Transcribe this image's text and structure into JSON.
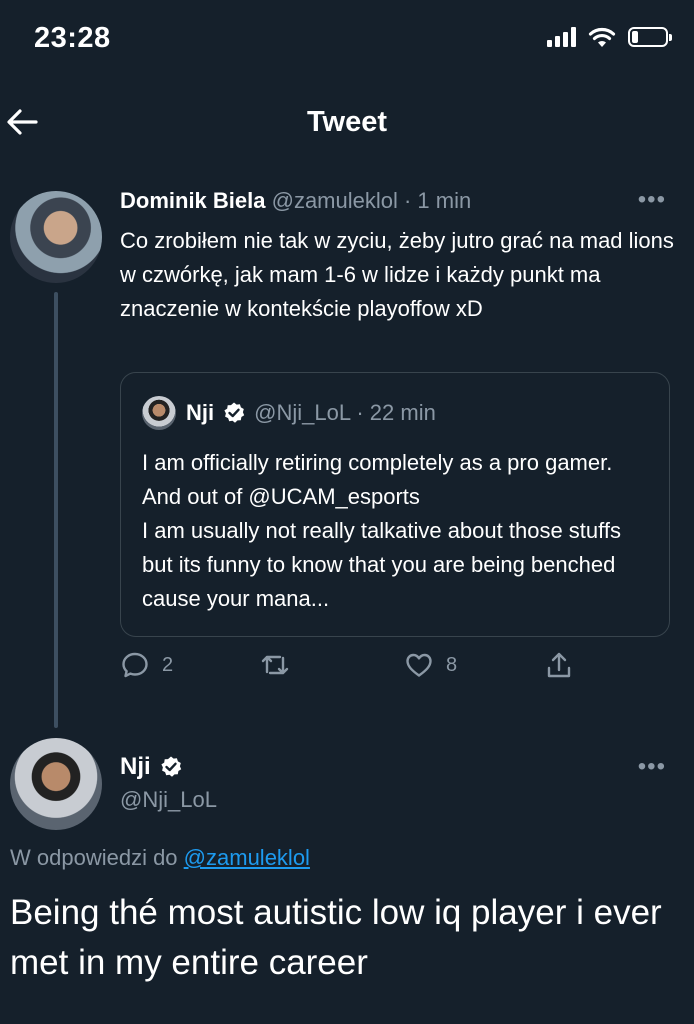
{
  "status_bar": {
    "time": "23:28"
  },
  "header": {
    "title": "Tweet"
  },
  "tweet": {
    "author_name": "Dominik Biela",
    "handle_time": "@zamuleklol · 1 min",
    "text": "Co zrobiłem nie tak w zyciu, żeby jutro grać na mad lions w czwórkę, jak mam 1-6 w lidze i każdy punkt ma znaczenie w kontekście playoffow xD",
    "more": "•••",
    "quote": {
      "author_name": "Nji",
      "handle_time": "@Nji_LoL · 22 min",
      "text": "I am officially retiring completely as a pro gamer. And out of @UCAM_esports\nI am usually not really talkative about those stuffs but its funny to know that you are being benched cause your mana..."
    },
    "actions": {
      "reply_count": "2",
      "like_count": "8"
    }
  },
  "reply": {
    "author_name": "Nji",
    "handle": "@Nji_LoL",
    "more": "•••",
    "reply_prefix": "W odpowiedzi do",
    "reply_target": "@zamuleklol",
    "text": "Being thé most autistic low iq player i ever met in my entire career"
  },
  "colors": {
    "background": "#15202b",
    "accent": "#1d9bf0",
    "muted": "#8b98a5"
  }
}
